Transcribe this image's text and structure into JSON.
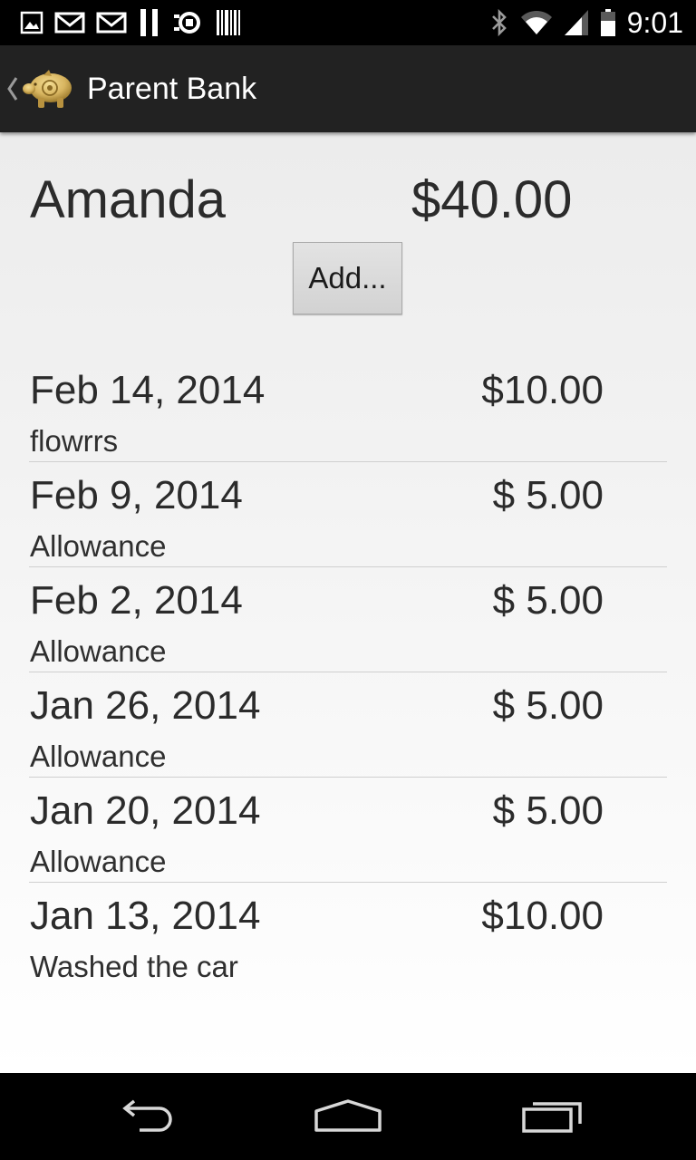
{
  "status_bar": {
    "time": "9:01",
    "notification_icons": [
      "image-icon",
      "gmail-icon",
      "gmail-icon",
      "pause-icon",
      "sync-icon",
      "barcode-icon"
    ],
    "system_icons": [
      "bluetooth-icon",
      "wifi-icon",
      "signal-icon",
      "battery-icon"
    ]
  },
  "action_bar": {
    "title": "Parent Bank",
    "up_icon": "chevron-left-icon",
    "app_icon": "piggy-bank-icon"
  },
  "account": {
    "name": "Amanda",
    "balance": "$40.00"
  },
  "add_button": {
    "label": "Add..."
  },
  "transactions": [
    {
      "date": "Feb 14, 2014",
      "amount": "$10.00",
      "note": "flowrrs"
    },
    {
      "date": "Feb 9, 2014",
      "amount": "$ 5.00",
      "note": "Allowance"
    },
    {
      "date": "Feb 2, 2014",
      "amount": "$ 5.00",
      "note": "Allowance"
    },
    {
      "date": "Jan 26, 2014",
      "amount": "$ 5.00",
      "note": "Allowance"
    },
    {
      "date": "Jan 20, 2014",
      "amount": "$ 5.00",
      "note": "Allowance"
    },
    {
      "date": "Jan 13, 2014",
      "amount": "$10.00",
      "note": "Washed the car"
    }
  ],
  "nav_bar": {
    "back_icon": "back-icon",
    "home_icon": "home-icon",
    "recents_icon": "recents-icon"
  },
  "colors": {
    "action_bar": "#222222",
    "status_bar": "#000000",
    "nav_bar": "#000000",
    "text": "#2b2b2b",
    "divider": "#cfcfcf",
    "app_icon_gold": "#d8b560"
  }
}
